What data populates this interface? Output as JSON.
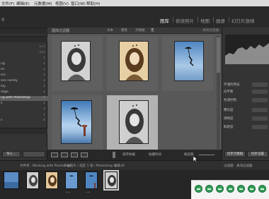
{
  "menubar": {
    "items": [
      "文件(F)",
      "编辑(E)",
      "元数据(M)",
      "视图(V)",
      "窗口(W)",
      "帮助(H)"
    ]
  },
  "app": {
    "brand_fragment": "6"
  },
  "modules": [
    {
      "label": "图库",
      "active": true
    },
    {
      "label": "修改照片",
      "active": false
    },
    {
      "label": "地图",
      "active": false
    },
    {
      "label": "画册",
      "active": false
    },
    {
      "label": "幻灯片放映",
      "active": false
    }
  ],
  "left_panel": {
    "rows": [
      {
        "label": "",
        "count": "177"
      },
      {
        "label": "",
        "count": "127"
      },
      {
        "label": "",
        "count": "1"
      },
      {
        "label": "ng",
        "count": "1"
      },
      {
        "label": "es",
        "count": "2"
      },
      {
        "label": "ers",
        "count": "1"
      },
      {
        "label": "ons Family",
        "count": "2"
      },
      {
        "label": "lity",
        "count": "2"
      },
      {
        "label": "dogs",
        "count": "2"
      },
      {
        "label": "ng with Photoshop",
        "count": "6",
        "selected": true
      },
      {
        "label": "s",
        "count": "1"
      },
      {
        "label": "",
        "count": "2"
      },
      {
        "label": "",
        "count": "1"
      },
      {
        "label": "s",
        "count": "4"
      }
    ],
    "import_label": "导入..."
  },
  "filter_bar": {
    "title": "图库过滤器",
    "options": [
      {
        "label": "文本",
        "active": false
      },
      {
        "label": "属性",
        "active": false
      },
      {
        "label": "元数据",
        "active": false
      },
      {
        "label": "无",
        "active": true
      }
    ],
    "preset": "关闭过滤器"
  },
  "toolbar": {
    "sort_label": "排序依据",
    "sort_value": "拍摄时间",
    "thumb_label": "缩览图"
  },
  "right_panel": {
    "rows": [
      {
        "label": "存储的预设"
      },
      {
        "label": "白平衡"
      },
      {
        "label": "色调控制"
      },
      {
        "label": "曝光度"
      },
      {
        "label": "清晰度"
      },
      {
        "label": "鲜艳度"
      }
    ],
    "sync_meta_label": "同步元数据",
    "sync_settings_label": "同步设置"
  },
  "filmbar": {
    "folder_label": "文件夹 : Working with Photoshop",
    "count_label": "5 张照片 / 选定 1 张 / Photoshop 编辑.tif",
    "filter_label": "过滤器:",
    "filter_value": "关闭过滤器"
  },
  "icons": {
    "grid_view": "grid-icon",
    "loupe_view": "loupe-icon",
    "compare_view": "compare-icon",
    "survey_view": "survey-icon",
    "painter": "spray-can-icon"
  },
  "colors": {
    "accent_tray": "#2f9e56",
    "selected_cell": "#b3b3b3"
  }
}
